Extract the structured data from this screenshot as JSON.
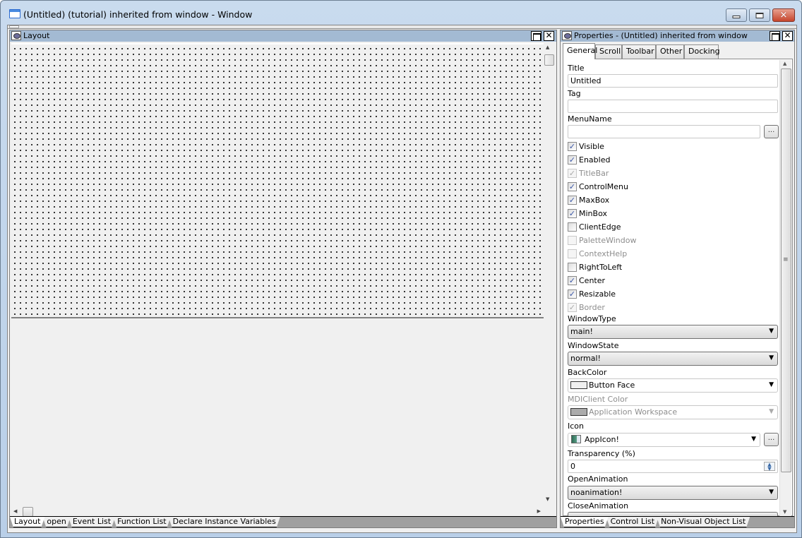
{
  "window": {
    "title": "(Untitled) (tutorial) inherited from window - Window",
    "buttons": {
      "minimize": "minimize",
      "maximize": "maximize",
      "close": "✕"
    }
  },
  "layout_pane": {
    "title": "Layout",
    "bottom_tabs": [
      {
        "label": "Layout",
        "active": true
      },
      {
        "label": "open",
        "active": false
      },
      {
        "label": "Event List",
        "active": false
      },
      {
        "label": "Function List",
        "active": false
      },
      {
        "label": "Declare Instance Variables",
        "active": false
      }
    ]
  },
  "properties_pane": {
    "title": "Properties -  (Untitled)  inherited  from  window",
    "tabs": [
      {
        "label": "General",
        "active": true
      },
      {
        "label": "Scroll",
        "active": false
      },
      {
        "label": "Toolbar",
        "active": false
      },
      {
        "label": "Other",
        "active": false
      },
      {
        "label": "Docking",
        "active": false
      }
    ],
    "fields": {
      "title_label": "Title",
      "title_value": "Untitled",
      "tag_label": "Tag",
      "tag_value": "",
      "menuname_label": "MenuName",
      "menuname_value": "",
      "ellipsis": "...",
      "windowtype_label": "WindowType",
      "windowtype_value": "main!",
      "windowstate_label": "WindowState",
      "windowstate_value": "normal!",
      "backcolor_label": "BackColor",
      "backcolor_value": "Button Face",
      "backcolor_swatch": "#f0f0f0",
      "mdiclient_label": "MDIClient Color",
      "mdiclient_value": "Application Workspace",
      "mdiclient_swatch": "#ababab",
      "icon_label": "Icon",
      "icon_value": "AppIcon!",
      "transparency_label": "Transparency (%)",
      "transparency_value": "0",
      "openanimation_label": "OpenAnimation",
      "openanimation_value": "noanimation!",
      "closeanimation_label": "CloseAnimation"
    },
    "checkboxes": [
      {
        "label": "Visible",
        "checked": true,
        "enabled": true
      },
      {
        "label": "Enabled",
        "checked": true,
        "enabled": true
      },
      {
        "label": "TitleBar",
        "checked": true,
        "enabled": false
      },
      {
        "label": "ControlMenu",
        "checked": true,
        "enabled": true
      },
      {
        "label": "MaxBox",
        "checked": true,
        "enabled": true
      },
      {
        "label": "MinBox",
        "checked": true,
        "enabled": true
      },
      {
        "label": "ClientEdge",
        "checked": false,
        "enabled": true
      },
      {
        "label": "PaletteWindow",
        "checked": false,
        "enabled": false
      },
      {
        "label": "ContextHelp",
        "checked": false,
        "enabled": false
      },
      {
        "label": "RightToLeft",
        "checked": false,
        "enabled": true
      },
      {
        "label": "Center",
        "checked": true,
        "enabled": true
      },
      {
        "label": "Resizable",
        "checked": true,
        "enabled": true
      },
      {
        "label": "Border",
        "checked": true,
        "enabled": false
      }
    ],
    "bottom_tabs": [
      {
        "label": "Properties",
        "active": true
      },
      {
        "label": "Control List",
        "active": false
      },
      {
        "label": "Non-Visual Object List",
        "active": false
      }
    ]
  },
  "icons": {
    "check": "✓",
    "dropdown_arrow": "▼",
    "scroll_up": "▲",
    "scroll_down": "▼",
    "scroll_left": "◀",
    "scroll_right": "▶",
    "pane_close": "✕",
    "spin": "▲▼"
  }
}
